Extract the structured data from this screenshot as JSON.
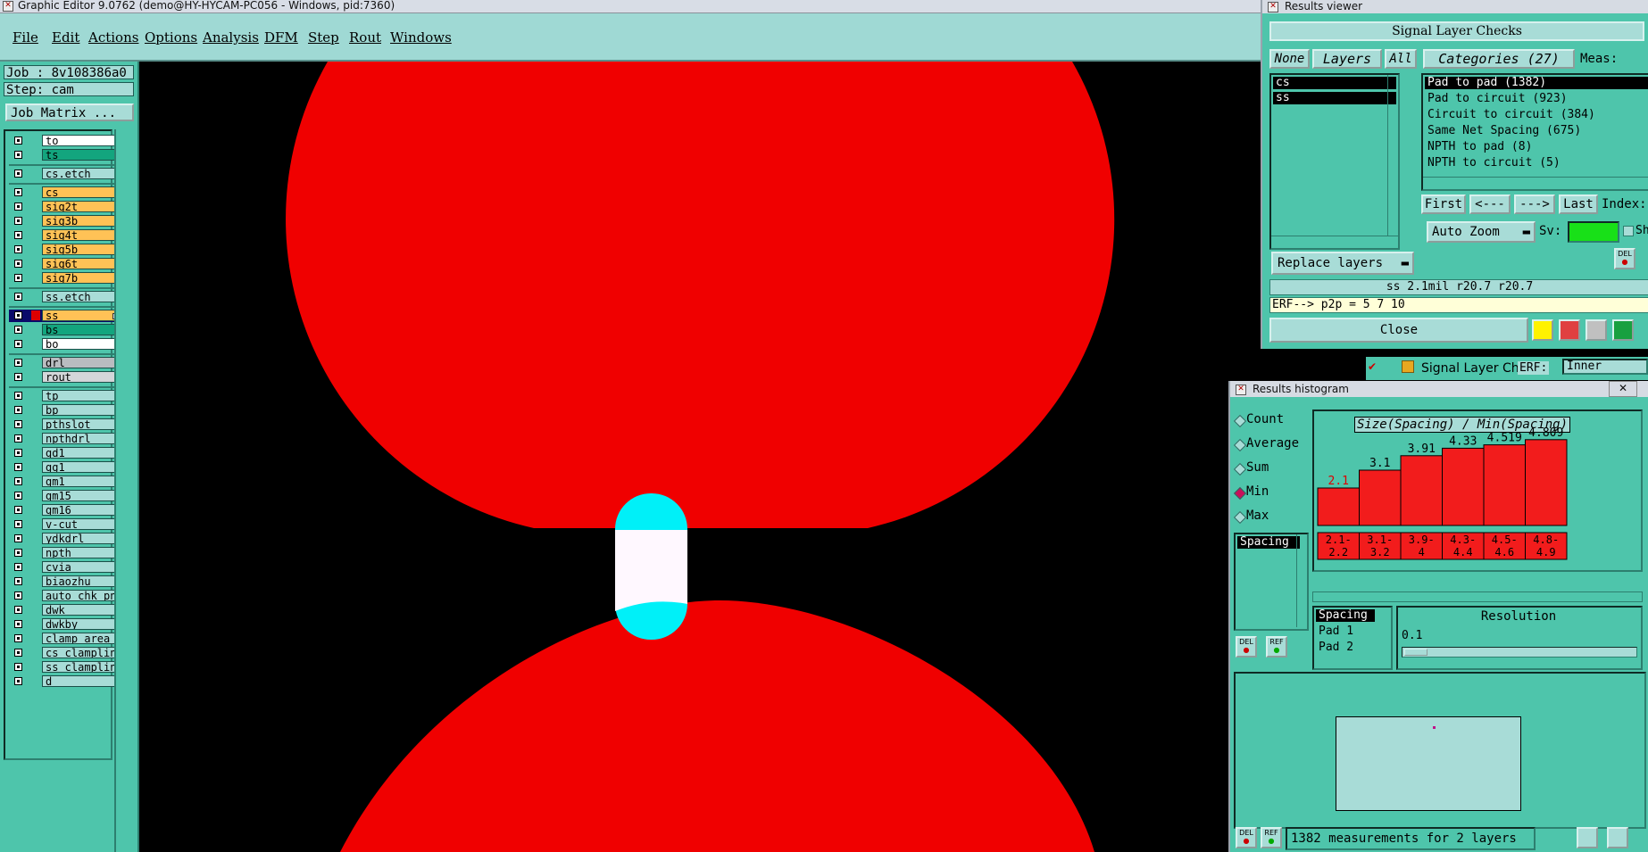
{
  "app": {
    "title": "Graphic Editor 9.0762 (demo@HY-HYCAM-PC056 - Windows, pid:7360)"
  },
  "menu": [
    "File",
    "Edit",
    "Actions",
    "Options",
    "Analysis",
    "DFM",
    "Step",
    "Rout",
    "Windows"
  ],
  "left": {
    "job": "Job : 8v108386a0",
    "step": "Step: cam",
    "job_matrix": "Job Matrix ...",
    "layers": [
      {
        "name": "to",
        "color": "#ffffff"
      },
      {
        "name": "ts",
        "color": "#13a57e"
      },
      {
        "name": "cs.etch",
        "color": "#a8dcd7"
      },
      {
        "name": "cs",
        "color": "#ffc256"
      },
      {
        "name": "sig2t",
        "color": "#ffc256"
      },
      {
        "name": "sig3b",
        "color": "#ffc256"
      },
      {
        "name": "sig4t",
        "color": "#ffc256"
      },
      {
        "name": "sig5b",
        "color": "#ffc256"
      },
      {
        "name": "sig6t",
        "color": "#ffc256"
      },
      {
        "name": "sig7b",
        "color": "#ffc256"
      },
      {
        "name": "ss.etch",
        "color": "#a8dcd7"
      },
      {
        "name": "ss",
        "color": "#ffc256"
      },
      {
        "name": "bs",
        "color": "#13a57e"
      },
      {
        "name": "bo",
        "color": "#ffffff"
      },
      {
        "name": "drl",
        "color": "#b9bcc0"
      },
      {
        "name": "rout",
        "color": "#d3d6d9"
      },
      {
        "name": "tp",
        "color": "#a8dcd7"
      },
      {
        "name": "bp",
        "color": "#a8dcd7"
      },
      {
        "name": "pthslot",
        "color": "#a8dcd7"
      },
      {
        "name": "npthdrl",
        "color": "#a8dcd7"
      },
      {
        "name": "gd1",
        "color": "#a8dcd7"
      },
      {
        "name": "gg1",
        "color": "#a8dcd7"
      },
      {
        "name": "gm1",
        "color": "#a8dcd7"
      },
      {
        "name": "gm15",
        "color": "#a8dcd7"
      },
      {
        "name": "gm16",
        "color": "#a8dcd7"
      },
      {
        "name": "v-cut",
        "color": "#a8dcd7"
      },
      {
        "name": "ydkdrl",
        "color": "#a8dcd7"
      },
      {
        "name": "npth",
        "color": "#a8dcd7"
      },
      {
        "name": "cvia",
        "color": "#a8dcd7"
      },
      {
        "name": "biaozhu",
        "color": "#a8dcd7"
      },
      {
        "name": "auto_chk_pn",
        "color": "#a8dcd7"
      },
      {
        "name": "dwk",
        "color": "#a8dcd7"
      },
      {
        "name": "dwkby",
        "color": "#a8dcd7"
      },
      {
        "name": "clamp_area",
        "color": "#a8dcd7"
      },
      {
        "name": "cs_clampline",
        "color": "#a8dcd7"
      },
      {
        "name": "ss_clampline",
        "color": "#a8dcd7"
      },
      {
        "name": "d",
        "color": "#a8dcd7"
      }
    ]
  },
  "canvas": {
    "background": "#000000",
    "copper_color": "#f00000",
    "pad_color": "#00f0f8",
    "highlight_color": "#fff8ff"
  },
  "results_viewer": {
    "title": "Results viewer",
    "header": "Signal Layer Checks",
    "none_btn": "None",
    "layers_btn": "Layers",
    "all_btn": "All",
    "categories_btn": "Categories (27)",
    "meas_label": "Meas:",
    "layer_items": [
      "cs",
      "ss"
    ],
    "categories": [
      "Pad to pad (1382)",
      "Pad to circuit (923)",
      "Circuit to circuit (384)",
      "Same Net Spacing (675)",
      "NPTH to pad (8)",
      "NPTH to circuit (5)"
    ],
    "first": "First",
    "prev": "<---",
    "next": "--->",
    "last": "Last",
    "index_label": "Index:",
    "auto_zoom": "Auto Zoom",
    "sv_label": "Sv:",
    "sh_label": "Sh",
    "del_label": "DEL",
    "replace_layers": "Replace layers",
    "status": "ss 2.1mil   r20.7   r20.7",
    "erf": "ERF--> p2p = 5 7 10",
    "close": "Close",
    "below_label": "Signal Layer Ch",
    "below_erf": "ERF:",
    "below_field": "Inner"
  },
  "histogram": {
    "title": "Results histogram",
    "modes": [
      "Count",
      "Average",
      "Sum",
      "Min",
      "Max"
    ],
    "selected_mode": "Min",
    "list_items": [
      "Spacing"
    ],
    "chart_title": "Size(Spacing) / Min(Spacing)",
    "attr_items": [
      "Spacing",
      "Pad 1",
      "Pad 2"
    ],
    "resolution_label": "Resolution",
    "resolution_value": "0.1",
    "del_label": "DEL",
    "ref_label": "REF",
    "status": "1382 measurements for 2 layers"
  },
  "chart_data": {
    "type": "bar",
    "title": "Size(Spacing) / Min(Spacing)",
    "categories": [
      "2.1-2.2",
      "3.1-3.2",
      "3.9-4",
      "4.3-4.4",
      "4.5-4.6",
      "4.8-4.9"
    ],
    "values": [
      2.1,
      3.1,
      3.91,
      4.33,
      4.519,
      4.809
    ],
    "value_labels": [
      "2.1",
      "3.1",
      "3.91",
      "4.33",
      "4.519",
      "4.809"
    ],
    "bin_labels": [
      [
        "2.1-",
        "2.2"
      ],
      [
        "3.1-",
        "3.2"
      ],
      [
        "3.9-",
        "4"
      ],
      [
        "4.3-",
        "4.4"
      ],
      [
        "4.5-",
        "4.6"
      ],
      [
        "4.8-",
        "4.9"
      ]
    ],
    "ylim": [
      0,
      5.5
    ],
    "bar_color": "#f21c1c"
  }
}
